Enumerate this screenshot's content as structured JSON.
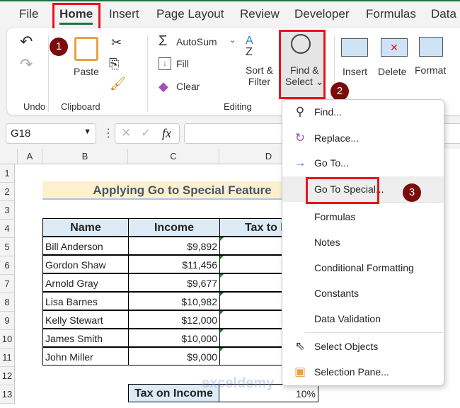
{
  "tabs": [
    "File",
    "Home",
    "Insert",
    "Page Layout",
    "Review",
    "Developer",
    "Formulas",
    "Data"
  ],
  "active_tab": "Home",
  "ribbon": {
    "groups": {
      "undo": "Undo",
      "clipboard": "Clipboard",
      "editing": "Editing"
    },
    "paste": "Paste",
    "autosum": "AutoSum",
    "fill": "Fill",
    "clear": "Clear",
    "sort_filter": [
      "Sort &",
      "Filter"
    ],
    "find_select": [
      "Find &",
      "Select"
    ],
    "insert": "Insert",
    "delete": "Delete",
    "format": "Format"
  },
  "badges": [
    "1",
    "2",
    "3"
  ],
  "name_box": "G18",
  "fx": "fx",
  "columns": [
    "A",
    "B",
    "C",
    "D"
  ],
  "rows": [
    "1",
    "2",
    "3",
    "4",
    "5",
    "6",
    "7",
    "8",
    "9",
    "10",
    "11",
    "12",
    "13"
  ],
  "sheet": {
    "title": "Applying Go to Special Feature",
    "headers": [
      "Name",
      "Income",
      "Tax to be"
    ],
    "data": [
      [
        "Bill Anderson",
        "$9,892"
      ],
      [
        "Gordon Shaw",
        "$11,456"
      ],
      [
        "Arnold Gray",
        "$9,677"
      ],
      [
        "Lisa Barnes",
        "$10,982"
      ],
      [
        "Kelly Stewart",
        "$12,000"
      ],
      [
        "James Smith",
        "$10,000"
      ],
      [
        "John Miller",
        "$9,000"
      ]
    ],
    "tax_label": "Tax on Income",
    "tax_value": "10%"
  },
  "menu": [
    {
      "label": "Find...",
      "icon": "magnifier-icon"
    },
    {
      "label": "Replace...",
      "icon": "replace-icon"
    },
    {
      "label": "Go To...",
      "icon": "arrow-right-icon"
    },
    {
      "label": "Go To Special...",
      "icon": ""
    },
    {
      "label": "Formulas",
      "icon": ""
    },
    {
      "label": "Notes",
      "icon": ""
    },
    {
      "label": "Conditional Formatting",
      "icon": ""
    },
    {
      "label": "Constants",
      "icon": ""
    },
    {
      "label": "Data Validation",
      "icon": ""
    },
    {
      "label": "Select Objects",
      "icon": "cursor-icon"
    },
    {
      "label": "Selection Pane...",
      "icon": "selection-pane-icon"
    }
  ],
  "watermark": "exceldemy"
}
